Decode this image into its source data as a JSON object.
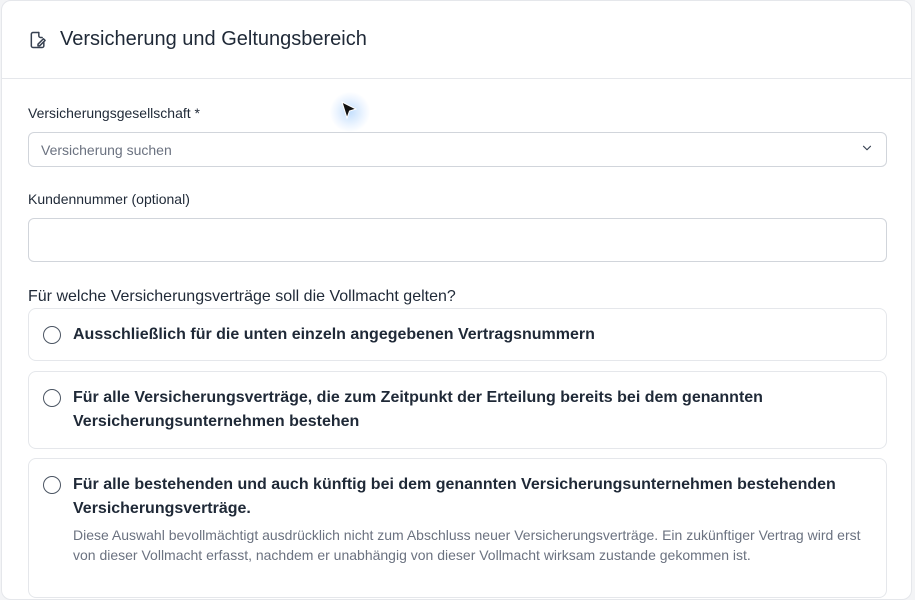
{
  "header": {
    "title": "Versicherung und Geltungsbereich",
    "icon": "edit-document-icon"
  },
  "insurer": {
    "label": "Versicherungsgesellschaft *",
    "placeholder": "Versicherung suchen"
  },
  "customer_number": {
    "label": "Kundennummer (optional)",
    "value": ""
  },
  "scope": {
    "question": "Für welche Versicherungsverträge soll die Vollmacht gelten?",
    "options": [
      {
        "label": "Ausschließlich für die unten einzeln angegebenen Vertragsnummern",
        "description": ""
      },
      {
        "label": "Für alle Versicherungsverträge, die zum Zeitpunkt der Erteilung bereits bei dem genannten Versicherungsunternehmen bestehen",
        "description": ""
      },
      {
        "label": "Für alle bestehenden und auch künftig bei dem genannten Versicherungsunternehmen bestehenden Versicherungsverträge.",
        "description": "Diese Auswahl bevollmächtigt ausdrücklich nicht zum Abschluss neuer Versicherungsverträge. Ein zukünftiger Vertrag wird erst von dieser Vollmacht erfasst, nachdem er unabhängig von dieser Vollmacht wirksam zustande gekommen ist."
      }
    ]
  },
  "colors": {
    "border": "#e5e7eb",
    "input_border": "#d1d5db",
    "muted_text": "#6b7280"
  }
}
